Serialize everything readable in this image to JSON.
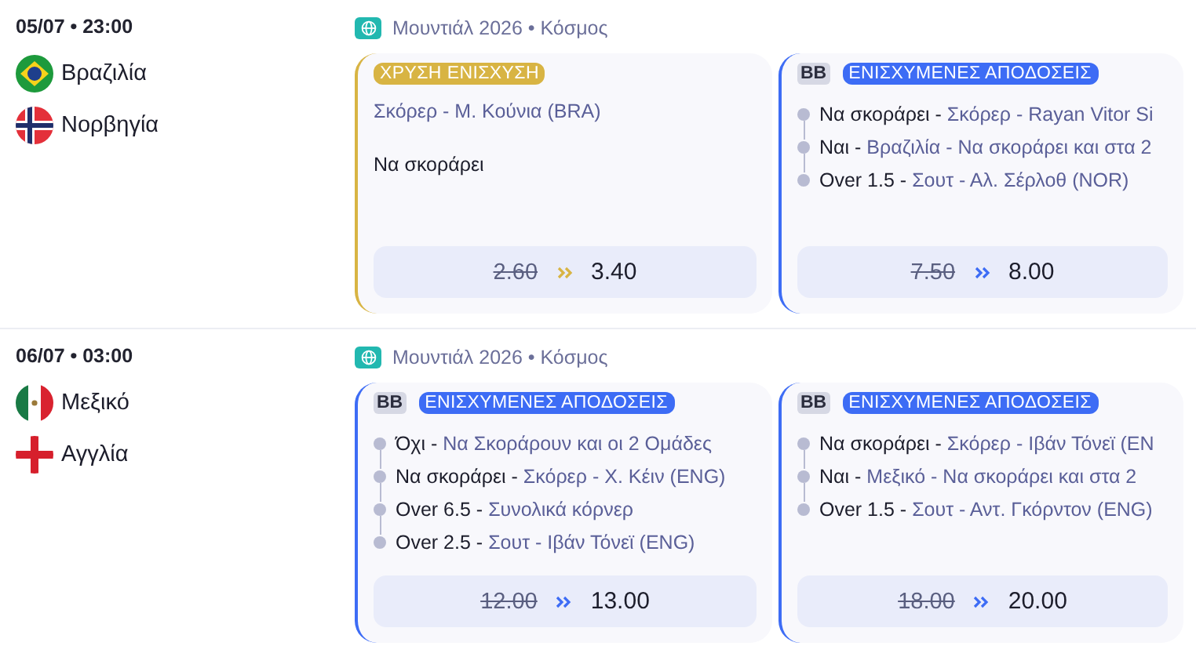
{
  "matches": [
    {
      "datetime": "05/07 • 23:00",
      "league": "Μουντιάλ 2026 • Κόσμος",
      "teams": [
        {
          "name": "Βραζιλία",
          "kind": "brazil"
        },
        {
          "name": "Νορβηγία",
          "kind": "norway"
        }
      ],
      "offers": [
        {
          "kind": "gold",
          "badge": "ΧΡΥΣΗ ΕΝΙΣΧΥΣΗ",
          "market": "Σκόρερ - Μ. Κούνια (BRA)",
          "pick": "Να σκοράρει",
          "old_odds": "2.60",
          "new_odds": "3.40"
        },
        {
          "kind": "bb",
          "tag": "BB",
          "badge": "ΕΝΙΣΧΥΜΕΝΕΣ ΑΠΟΔΟΣΕΙΣ",
          "legs": [
            {
              "pick": "Να σκοράρει -",
              "market": "Σκόρερ - Rayan Vitor Si"
            },
            {
              "pick": "Ναι -",
              "market": "Βραζιλία - Να σκοράρει και στα 2"
            },
            {
              "pick": "Over 1.5 -",
              "market": "Σουτ - Αλ. Σέρλοθ (NOR)"
            }
          ],
          "old_odds": "7.50",
          "new_odds": "8.00"
        }
      ]
    },
    {
      "datetime": "06/07 • 03:00",
      "league": "Μουντιάλ 2026 • Κόσμος",
      "teams": [
        {
          "name": "Μεξικό",
          "kind": "mexico"
        },
        {
          "name": "Αγγλία",
          "kind": "england"
        }
      ],
      "offers": [
        {
          "kind": "bb",
          "tag": "BB",
          "badge": "ΕΝΙΣΧΥΜΕΝΕΣ ΑΠΟΔΟΣΕΙΣ",
          "legs": [
            {
              "pick": "Όχι -",
              "market": "Να Σκοράρουν και οι 2 Ομάδες"
            },
            {
              "pick": "Να σκοράρει -",
              "market": "Σκόρερ - Χ. Κέιν (ENG)"
            },
            {
              "pick": "Over 6.5 -",
              "market": "Συνολικά κόρνερ"
            },
            {
              "pick": "Over 2.5 -",
              "market": "Σουτ - Ιβάν Τόνεϊ (ENG)"
            }
          ],
          "old_odds": "12.00",
          "new_odds": "13.00"
        },
        {
          "kind": "bb",
          "tag": "BB",
          "badge": "ΕΝΙΣΧΥΜΕΝΕΣ ΑΠΟΔΟΣΕΙΣ",
          "legs": [
            {
              "pick": "Να σκοράρει -",
              "market": "Σκόρερ - Ιβάν Τόνεϊ (EN"
            },
            {
              "pick": "Ναι -",
              "market": "Μεξικό - Να σκοράρει και στα 2"
            },
            {
              "pick": "Over 1.5 -",
              "market": "Σουτ - Αντ. Γκόρντον (ENG)"
            }
          ],
          "old_odds": "18.00",
          "new_odds": "20.00"
        }
      ]
    }
  ]
}
